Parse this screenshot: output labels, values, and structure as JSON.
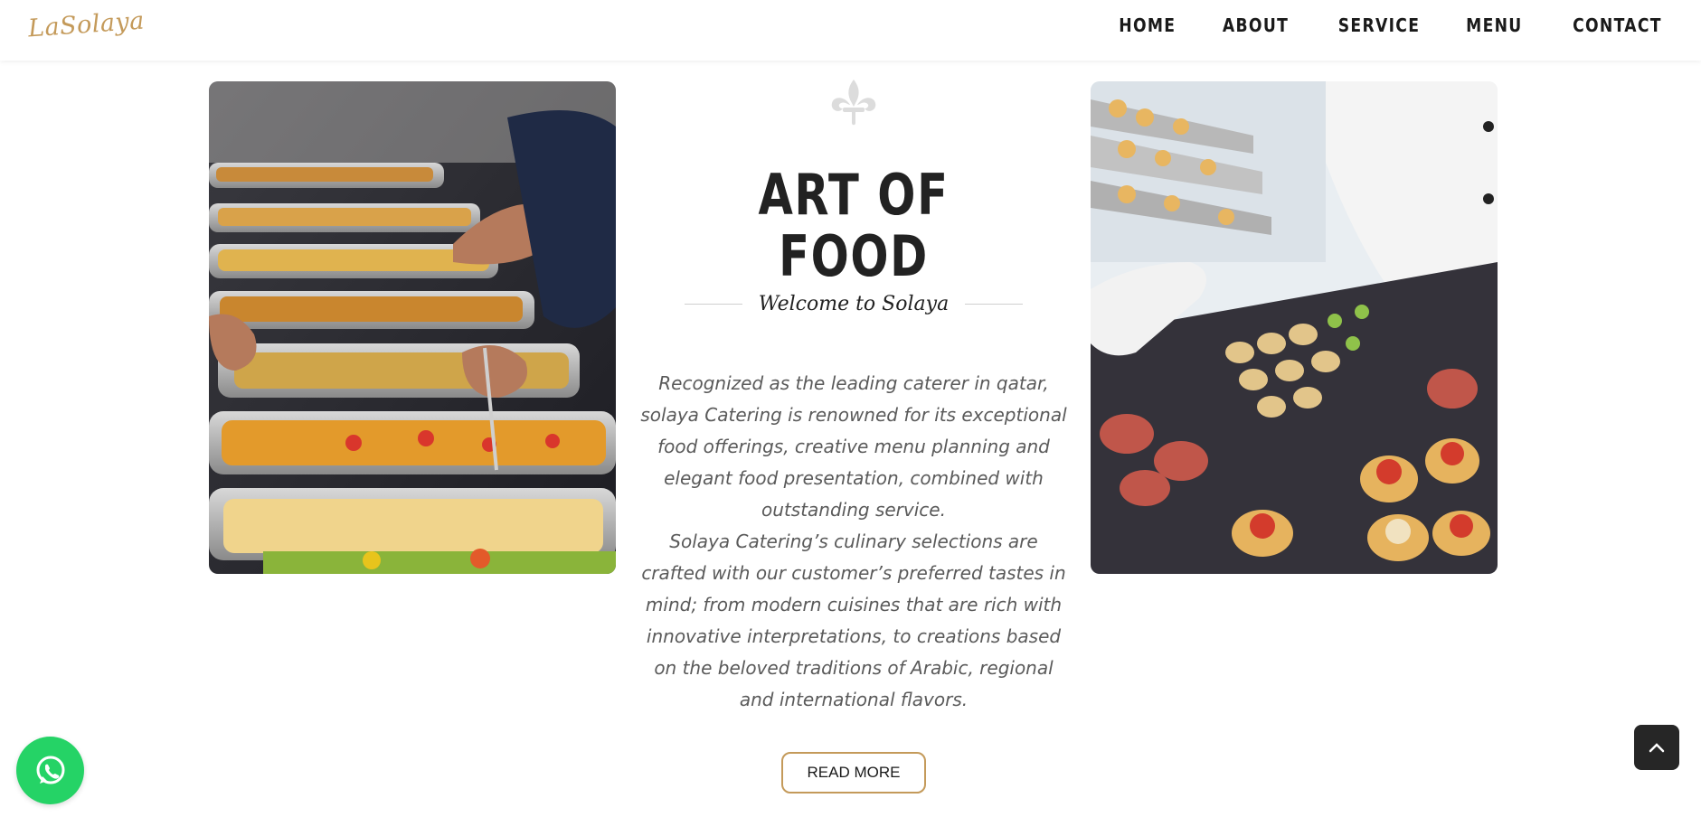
{
  "header": {
    "logo_text": "LaSolaya",
    "nav": [
      "HOME",
      "ABOUT",
      "SERVICE",
      "MENU",
      "CONTACT"
    ]
  },
  "main": {
    "title": "ART OF FOOD",
    "subtitle": "Welcome to Solaya",
    "paragraphs": [
      "Recognized as the leading caterer in qatar, solaya Catering is renowned for its exceptional food offerings, creative menu planning and elegant food presentation, combined with outstanding service.",
      "Solaya Catering’s culinary selections are crafted with our customer’s preferred tastes in mind; from modern cuisines that are rich with innovative interpretations, to creations based on the beloved traditions of Arabic, regional and international flavors."
    ],
    "read_more": "READ MORE",
    "left_image": "buffet-food-photo",
    "right_image": "chef-canapes-photo"
  },
  "floating": {
    "whatsapp_icon": "whatsapp-icon",
    "back_to_top_icon": "chevron-up-icon"
  },
  "colors": {
    "accent": "#c49a5a",
    "whatsapp": "#25d366",
    "dark": "#262626"
  }
}
